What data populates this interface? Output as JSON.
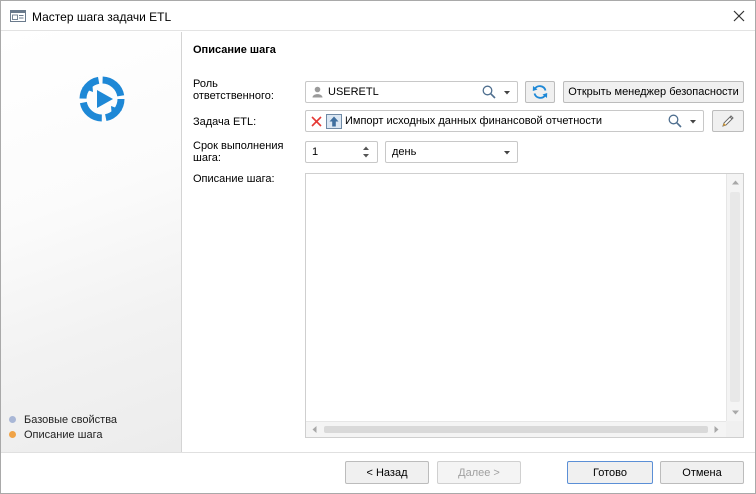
{
  "window": {
    "title": "Мастер шага задачи ETL"
  },
  "sidebar": {
    "steps": [
      {
        "label": "Базовые свойства",
        "color": "#a9b7d6"
      },
      {
        "label": "Описание шага",
        "color": "#f0a346"
      }
    ]
  },
  "main": {
    "section_title": "Описание шага",
    "role": {
      "label_line1": "Роль",
      "label_line2": "ответственного:",
      "value": "USERETL"
    },
    "security_button": "Открыть менеджер безопасности",
    "etl_task": {
      "label": "Задача ETL:",
      "value": "Импорт исходных данных финансовой отчетности"
    },
    "deadline": {
      "label_line1": "Срок выполнения",
      "label_line2": "шага:",
      "amount": "1",
      "unit": "день"
    },
    "description": {
      "label": "Описание шага:",
      "value": ""
    }
  },
  "footer": {
    "back": "< Назад",
    "next": "Далее >",
    "finish": "Готово",
    "cancel": "Отмена"
  },
  "colors": {
    "accent": "#1e88d6",
    "error": "#e53935"
  }
}
